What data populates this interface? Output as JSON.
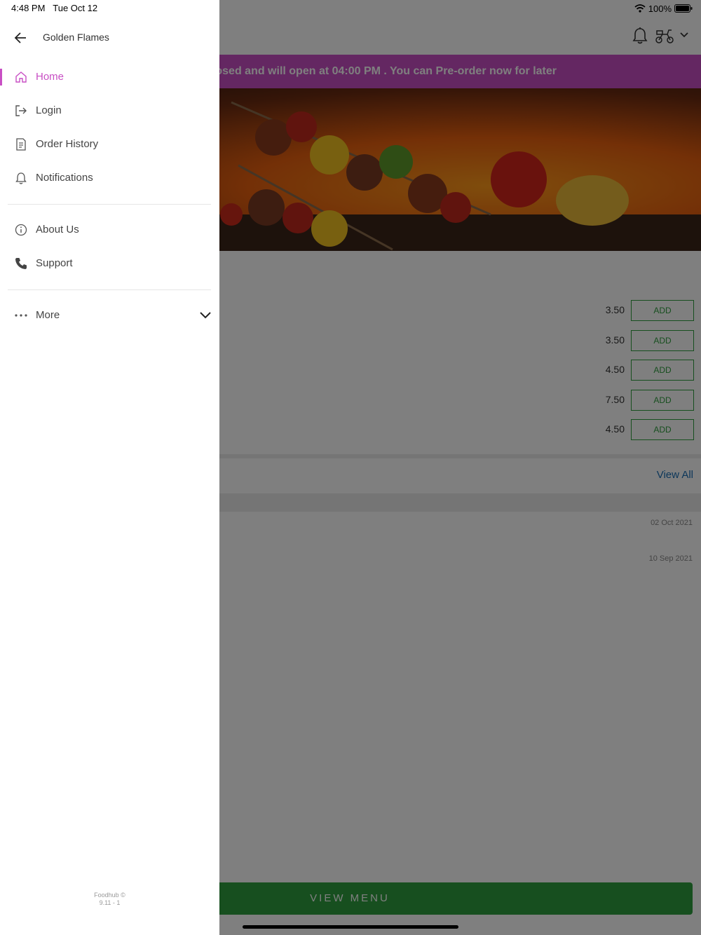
{
  "status_bar": {
    "time": "4:48 PM",
    "date": "Tue Oct 12",
    "battery": "100%"
  },
  "app": {
    "banner_text": "osed and will open at 04:00 PM . You can Pre-order now for later",
    "menu_items": [
      {
        "price": "3.50",
        "add_label": "ADD"
      },
      {
        "price": "3.50",
        "add_label": "ADD"
      },
      {
        "price": "4.50",
        "add_label": "ADD"
      },
      {
        "price": "7.50",
        "add_label": "ADD"
      },
      {
        "price": "4.50",
        "add_label": "ADD"
      }
    ],
    "view_all_label": "View All",
    "review_dates": [
      "02 Oct 2021",
      "10 Sep 2021"
    ],
    "view_menu_label": "VIEW MENU"
  },
  "drawer": {
    "title": "Golden Flames",
    "items": [
      {
        "label": "Home",
        "icon": "home-icon",
        "active": true
      },
      {
        "label": "Login",
        "icon": "login-icon"
      },
      {
        "label": "Order History",
        "icon": "receipt-icon"
      },
      {
        "label": "Notifications",
        "icon": "bell-icon"
      },
      {
        "label": "About Us",
        "icon": "info-icon"
      },
      {
        "label": "Support",
        "icon": "phone-icon"
      },
      {
        "label": "More",
        "icon": "more-dots-icon"
      }
    ],
    "footer_brand": "Foodhub ©",
    "footer_version": "9.11 - 1"
  },
  "colors": {
    "accent": "#c84fc4",
    "green": "#2f9e3f",
    "link": "#1a6fb5"
  }
}
